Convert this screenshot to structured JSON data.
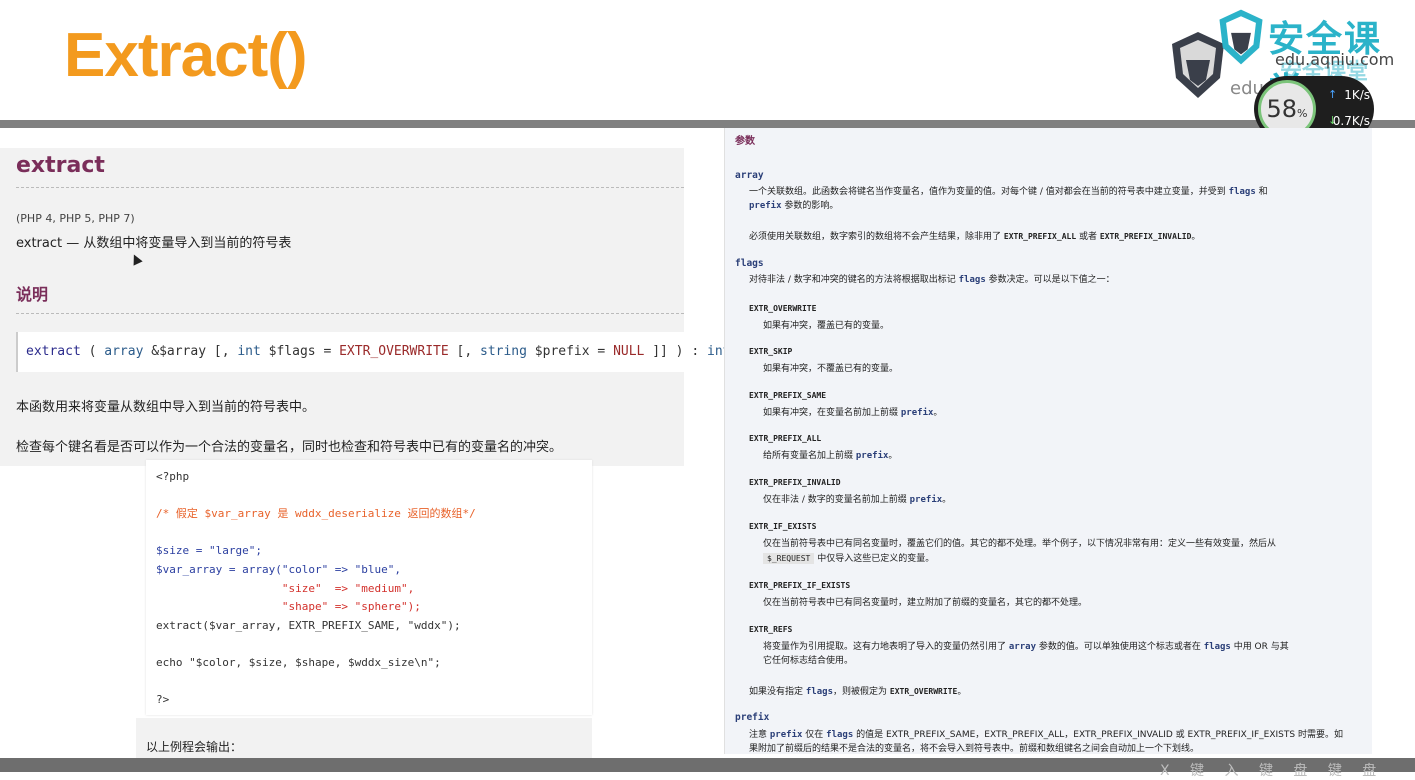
{
  "slide": {
    "title": "Extract()"
  },
  "logo": {
    "text_cn": "安全课堂",
    "text_cn2": "安全课堂",
    "text_url": "edu.aqniu.com",
    "text_url2": "edu.aqniu.com"
  },
  "net_widget": {
    "percent": "58",
    "percent_unit": "%",
    "up_rate": "1K/s",
    "down_rate": "0.7K/s"
  },
  "left": {
    "heading": "extract",
    "versions": "(PHP 4, PHP 5, PHP 7)",
    "summary": "extract — 从数组中将变量导入到当前的符号表",
    "section": "说明",
    "signature": {
      "fn": "extract",
      "open": " ( ",
      "t1": "array",
      "a1": " &$array [, ",
      "t2": "int",
      "a2": " $flags = ",
      "c1": "EXTR_OVERWRITE",
      "a3": " [, ",
      "t3": "string",
      "a4": " $prefix = ",
      "c2": "NULL",
      "close": " ]] ) : ",
      "ret": "int"
    },
    "para1": "本函数用来将变量从数组中导入到当前的符号表中。",
    "para2": "检查每个键名看是否可以作为一个合法的变量名，同时也检查和符号表中已有的变量名的冲突。",
    "code": [
      "<?php",
      "",
      "/* 假定 $var_array 是 wddx_deserialize 返回的数组*/",
      "",
      "$size = \"large\";",
      "$var_array = array(\"color\" => \"blue\",",
      "                   \"size\"  => \"medium\",",
      "                   \"shape\" => \"sphere\");",
      "extract($var_array, EXTR_PREFIX_SAME, \"wddx\");",
      "",
      "echo \"$color, $size, $shape, $wddx_size\\n\";",
      "",
      "?>"
    ],
    "output_label": "以上例程会输出："
  },
  "right": {
    "params_heading": "参数",
    "array_name": "array",
    "array_desc_1": "一个关联数组。此函数会将键名当作变量名，值作为变量的值。对每个键 / 值对都会在当前的符号表中建立变量，并受到",
    "array_desc_flags": "flags",
    "array_desc_and": " 和",
    "array_desc_prefix": "prefix",
    "array_desc_2": " 参数的影响。",
    "array_note_1": "必须使用关联数组，数字索引的数组将不会产生结果，除非用了",
    "array_note_c1": "EXTR_PREFIX_ALL",
    "array_note_or": " 或者 ",
    "array_note_c2": "EXTR_PREFIX_INVALID",
    "array_note_end": "。",
    "flags_name": "flags",
    "flags_desc_1": "对待非法 / 数字和冲突的键名的方法将根据取出标记",
    "flags_desc_k": "flags",
    "flags_desc_2": " 参数决定。可以是以下值之一：",
    "items": [
      {
        "const": "EXTR_OVERWRITE",
        "desc": "如果有冲突，覆盖已有的变量。"
      },
      {
        "const": "EXTR_SKIP",
        "desc": "如果有冲突，不覆盖已有的变量。"
      },
      {
        "const": "EXTR_PREFIX_SAME",
        "desc": "如果有冲突，在变量名前加上前缀",
        "kw": "prefix",
        "tail": "。"
      },
      {
        "const": "EXTR_PREFIX_ALL",
        "desc": "给所有变量名加上前缀",
        "kw": "prefix",
        "tail": "。"
      },
      {
        "const": "EXTR_PREFIX_INVALID",
        "desc": "仅在非法 / 数字的变量名前加上前缀",
        "kw": "prefix",
        "tail": "。"
      },
      {
        "const": "EXTR_IF_EXISTS",
        "desc": "仅在当前符号表中已有同名变量时，覆盖它们的值。其它的都不处理。举个例子，以下情况非常有用：定义一些有效变量，然后从",
        "desc2_code": "$_REQUEST",
        "desc2": " 中仅导入这些已定义的变量。"
      },
      {
        "const": "EXTR_PREFIX_IF_EXISTS",
        "desc": "仅在当前符号表中已有同名变量时，建立附加了前缀的变量名，其它的都不处理。"
      },
      {
        "const": "EXTR_REFS",
        "desc": "将变量作为引用提取。这有力地表明了导入的变量仍然引用了",
        "kw": "array",
        "desc_mid": " 参数的值。可以单独使用这个标志或者在",
        "kw2": "flags",
        "desc_end": " 中用 OR 与其",
        "desc2": "它任何标志结合使用。"
      }
    ],
    "default_note_1": "如果没有指定",
    "default_note_k": "flags",
    "default_note_2": "，则被假定为",
    "default_note_c": "EXTR_OVERWRITE",
    "default_note_end": "。",
    "prefix_name": "prefix",
    "prefix_desc_1": "注意",
    "prefix_desc_k1": "prefix",
    "prefix_desc_2": " 仅在",
    "prefix_desc_k2": "flags",
    "prefix_desc_3": " 的值是 EXTR_PREFIX_SAME，EXTR_PREFIX_ALL，EXTR_PREFIX_INVALID 或 EXTR_PREFIX_IF_EXISTS 时需要。如",
    "prefix_desc_4": "果附加了前缀后的结果不是合法的变量名，将不会导入到符号表中。前缀和数组键名之间会自动加上一个下划线。"
  },
  "bottom_text": "X 键 入 键 盘 键 盘"
}
